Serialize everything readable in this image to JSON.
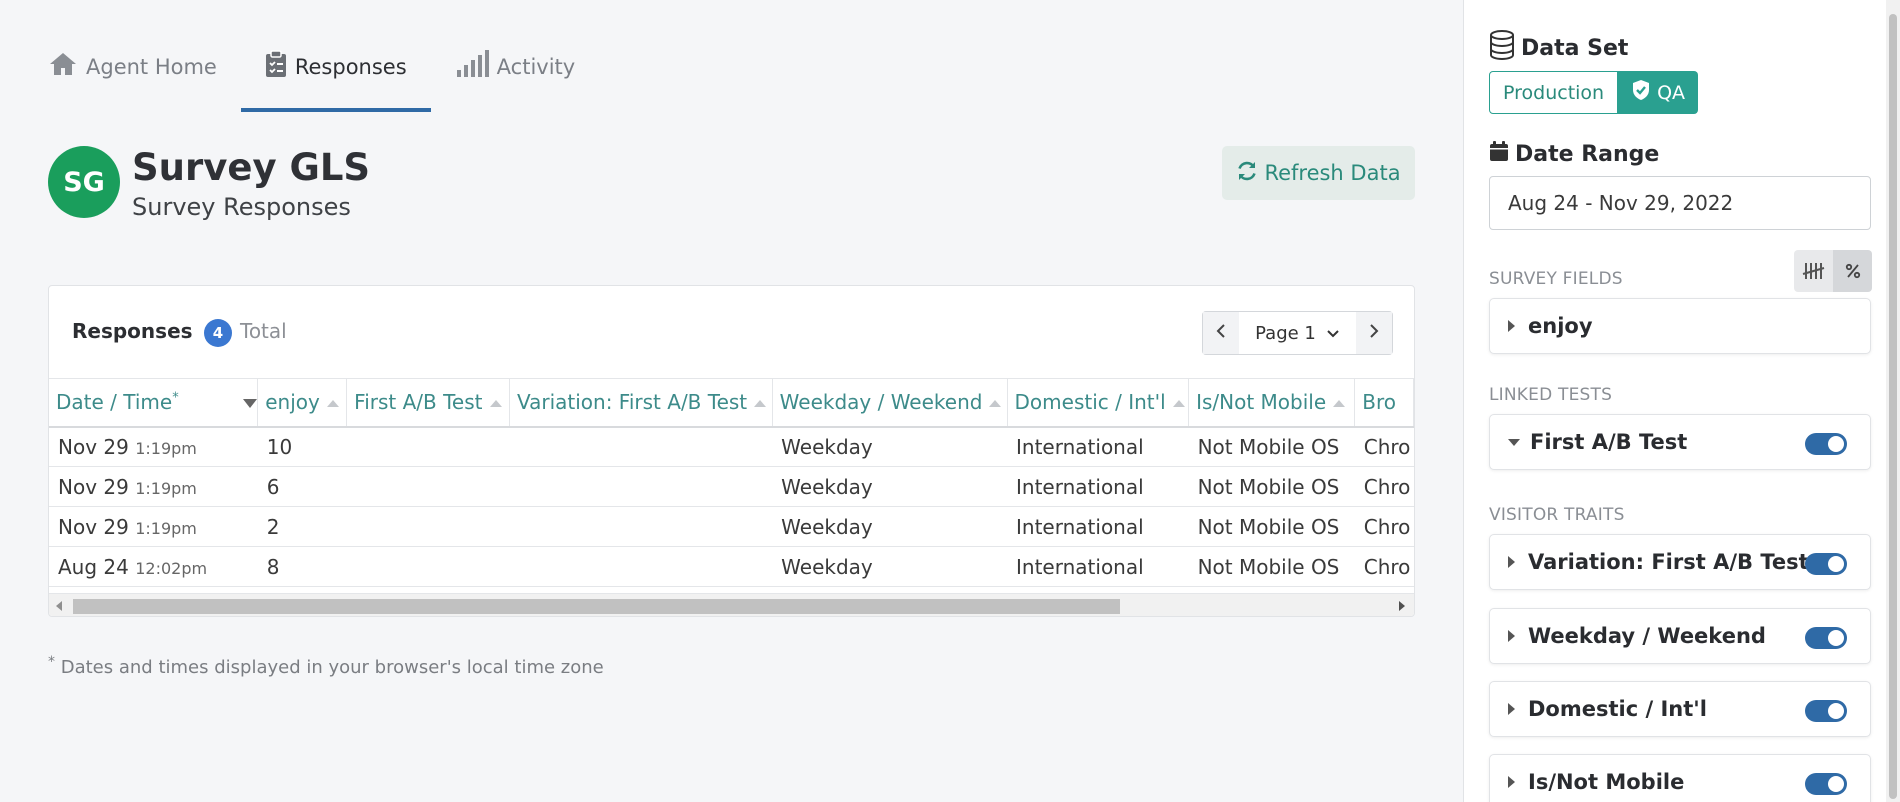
{
  "nav": {
    "tabs": [
      {
        "label": "Agent Home",
        "icon": "home-icon"
      },
      {
        "label": "Responses",
        "icon": "clipboard-icon",
        "active": true
      },
      {
        "label": "Activity",
        "icon": "signal-bars-icon"
      }
    ]
  },
  "header": {
    "avatar_initials": "SG",
    "title": "Survey GLS",
    "subtitle": "Survey Responses",
    "refresh_label": "Refresh Data"
  },
  "responses": {
    "title": "Responses",
    "count": "4",
    "count_label": "Total",
    "page_label": "Page 1",
    "columns": [
      "Date / Time",
      "enjoy",
      "First A/B Test",
      "Variation: First A/B Test",
      "Weekday / Weekend",
      "Domestic / Int'l",
      "Is/Not Mobile",
      "Bro"
    ],
    "date_marker": "*",
    "rows": [
      {
        "date": "Nov 29",
        "time": "1:19pm",
        "enjoy": "10",
        "ab": "",
        "variation": "",
        "weekday": "Weekday",
        "domestic": "International",
        "mobile": "Not Mobile OS",
        "browser": "Chro"
      },
      {
        "date": "Nov 29",
        "time": "1:19pm",
        "enjoy": "6",
        "ab": "",
        "variation": "",
        "weekday": "Weekday",
        "domestic": "International",
        "mobile": "Not Mobile OS",
        "browser": "Chro"
      },
      {
        "date": "Nov 29",
        "time": "1:19pm",
        "enjoy": "2",
        "ab": "",
        "variation": "",
        "weekday": "Weekday",
        "domestic": "International",
        "mobile": "Not Mobile OS",
        "browser": "Chro"
      },
      {
        "date": "Aug 24",
        "time": "12:02pm",
        "enjoy": "8",
        "ab": "",
        "variation": "",
        "weekday": "Weekday",
        "domestic": "International",
        "mobile": "Not Mobile OS",
        "browser": "Chro"
      }
    ]
  },
  "footnote": {
    "marker": "*",
    "text": "Dates and times displayed in your browser's local time zone"
  },
  "sidebar": {
    "data_set_label": "Data Set",
    "data_set_options": [
      "Production",
      "QA"
    ],
    "data_set_selected": "QA",
    "date_range_label": "Date Range",
    "date_range_value": "Aug 24 - Nov 29, 2022",
    "survey_fields_label": "SURVEY FIELDS",
    "survey_fields": [
      "enjoy"
    ],
    "linked_tests_label": "LINKED TESTS",
    "linked_tests": [
      {
        "label": "First A/B Test",
        "enabled": true
      }
    ],
    "visitor_traits_label": "VISITOR TRAITS",
    "visitor_traits": [
      {
        "label": "Variation: First A/B Test",
        "enabled": true
      },
      {
        "label": "Weekday / Weekend",
        "enabled": true
      },
      {
        "label": "Domestic / Int'l",
        "enabled": true
      },
      {
        "label": "Is/Not Mobile",
        "enabled": true
      }
    ],
    "display_toggle": [
      "count",
      "percent"
    ]
  },
  "colors": {
    "accent_teal": "#2aa090",
    "primary_blue": "#2f6aa6",
    "avatar_green": "#1a9e5c"
  }
}
